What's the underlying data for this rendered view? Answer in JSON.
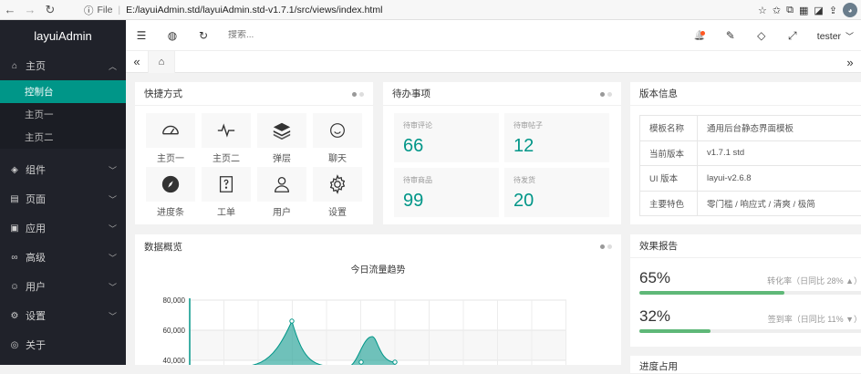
{
  "browser": {
    "back": "←",
    "forward": "→",
    "reload": "↻",
    "info": "ⓘ",
    "file_label": "File",
    "separator": "|",
    "url": "E:/layuiAdmin.std/layuiAdmin.std-v1.7.1/src/views/index.html",
    "avatar_text": "◕"
  },
  "sidebar": {
    "logo": "layuiAdmin",
    "home": {
      "label": "主页",
      "icon": "⌂",
      "chev": "︿"
    },
    "home_children": [
      {
        "label": "控制台",
        "active": true
      },
      {
        "label": "主页一",
        "active": false
      },
      {
        "label": "主页二",
        "active": false
      }
    ],
    "items": [
      {
        "label": "组件",
        "icon": "◈",
        "chev": "﹀"
      },
      {
        "label": "页面",
        "icon": "▤",
        "chev": "﹀"
      },
      {
        "label": "应用",
        "icon": "▣",
        "chev": "﹀"
      },
      {
        "label": "高级",
        "icon": "∞",
        "chev": "﹀"
      },
      {
        "label": "用户",
        "icon": "☺",
        "chev": "﹀"
      },
      {
        "label": "设置",
        "icon": "⚙",
        "chev": "﹀"
      },
      {
        "label": "关于",
        "icon": "◎",
        "chev": ""
      }
    ]
  },
  "topbar": {
    "menu_icon": "☰",
    "web_icon": "◍",
    "refresh_icon": "↻",
    "search_placeholder": "搜索...",
    "bell_icon": "🔔",
    "chat_icon": "✎",
    "tag_icon": "◇",
    "fullscreen_icon": "⤢",
    "user": "tester",
    "user_chev": "﹀"
  },
  "tabs": {
    "prev": "«",
    "home": "⌂",
    "next": "»"
  },
  "shortcuts": {
    "title": "快捷方式",
    "items": [
      {
        "label": "主页一",
        "icon": "gauge-icon"
      },
      {
        "label": "主页二",
        "icon": "pulse-icon"
      },
      {
        "label": "弹层",
        "icon": "layers-icon"
      },
      {
        "label": "聊天",
        "icon": "smile-icon"
      },
      {
        "label": "进度条",
        "icon": "compass-icon"
      },
      {
        "label": "工单",
        "icon": "ticket-icon"
      },
      {
        "label": "用户",
        "icon": "user-icon"
      },
      {
        "label": "设置",
        "icon": "gear-icon"
      }
    ]
  },
  "todo": {
    "title": "待办事项",
    "items": [
      {
        "label": "待审评论",
        "value": "66"
      },
      {
        "label": "待审帖子",
        "value": "12"
      },
      {
        "label": "待审商品",
        "value": "99"
      },
      {
        "label": "待发货",
        "value": "20"
      }
    ]
  },
  "version": {
    "title": "版本信息",
    "rows": [
      {
        "key": "模板名称",
        "value": "通用后台静态界面模板"
      },
      {
        "key": "当前版本",
        "value": "v1.7.1 std"
      },
      {
        "key": "UI 版本",
        "value": "layui-v2.6.8"
      },
      {
        "key": "主要特色",
        "value": "零门槛 / 响应式 / 清爽 / 极简"
      }
    ]
  },
  "overview": {
    "title": "数据概览"
  },
  "report": {
    "title": "效果报告",
    "rows": [
      {
        "value": "65%",
        "fraction": 0.65,
        "label": "转化率（日同比 28% ▲）"
      },
      {
        "value": "32%",
        "fraction": 0.32,
        "label": "签到率（日同比 11% ▼）"
      }
    ]
  },
  "progress_card": {
    "title": "进度占用"
  },
  "chart_data": {
    "type": "area",
    "title": "今日流量趋势",
    "y_ticks": [
      "80,000",
      "60,000",
      "40,000"
    ],
    "ylim": [
      40000,
      80000
    ],
    "grid": true,
    "color": "#009688"
  },
  "colors": {
    "accent": "#009688",
    "sidebar_bg": "#20222a",
    "bar": "#5fb878"
  }
}
